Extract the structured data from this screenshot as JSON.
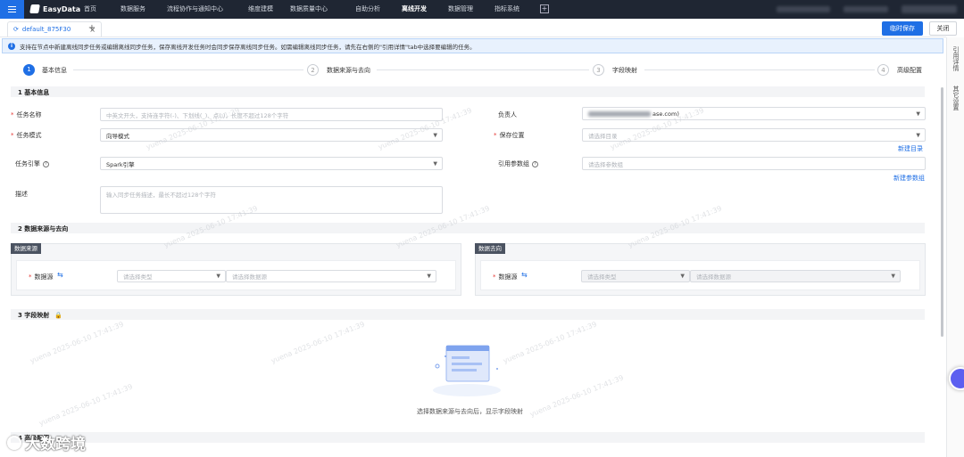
{
  "app": {
    "brand": "EasyData"
  },
  "nav": {
    "items": [
      "首页",
      "数据服务",
      "流程协作与通知中心",
      "维度建模",
      "数据质量中心",
      "自助分析",
      "离线开发",
      "数据管理",
      "指标系统"
    ],
    "active": "离线开发",
    "plus": "+"
  },
  "tabs": {
    "items": [
      {
        "label": "default_875F30",
        "close": "×"
      }
    ],
    "add": "+"
  },
  "toolbar": {
    "save": "临时保存",
    "close": "关闭"
  },
  "right_rail": {
    "items": [
      "引用详情",
      "其它设置"
    ]
  },
  "info": {
    "icon": "i",
    "text": "支持在节点中新建离线同步任务或编辑离线同步任务，保存离线开发任务时会同步保存离线同步任务。如需编辑离线同步任务，请先在右侧的\"引用详情\"tab中选择要编辑的任务。"
  },
  "steps": [
    {
      "num": "1",
      "label": "基本信息"
    },
    {
      "num": "2",
      "label": "数据来源与去向"
    },
    {
      "num": "3",
      "label": "字段映射"
    },
    {
      "num": "4",
      "label": "高级配置"
    }
  ],
  "sections": {
    "basic": "1 基本信息",
    "source": "2 数据来源与去向",
    "mapping": "3 字段映射",
    "advanced": "4 高级配置"
  },
  "form": {
    "task_name": {
      "label": "任务名称",
      "placeholder": "中英文开头，支持连字符(-)、下划线(_)、点(.)，长度不超过128个字符"
    },
    "task_mode": {
      "label": "任务模式",
      "value": "向导模式"
    },
    "engine": {
      "label": "任务引擎",
      "value": "Spark引擎"
    },
    "description": {
      "label": "描述",
      "placeholder": "输入同步任务描述，最长不超过128个字符"
    },
    "owner": {
      "label": "负责人",
      "value": "ase.com)"
    },
    "save_location": {
      "label": "保存位置",
      "placeholder": "请选择目录",
      "link": "新建目录"
    },
    "param_group": {
      "label": "引用参数组",
      "placeholder": "请选择参数组",
      "link": "新建参数组"
    }
  },
  "source": {
    "origin": {
      "title": "数据来源",
      "label": "数据源",
      "type_placeholder": "请选择类型",
      "ds_placeholder": "请选择数据源"
    },
    "target": {
      "title": "数据去向",
      "label": "数据源",
      "type_placeholder": "请选择类型",
      "ds_placeholder": "请选择数据源"
    }
  },
  "mapping": {
    "empty_text": "选择数据来源与去向后，显示字段映射"
  },
  "watermark": {
    "text": "yuena 2025-06-10 17:41:39"
  },
  "overlay": {
    "text": "大数跨境"
  }
}
